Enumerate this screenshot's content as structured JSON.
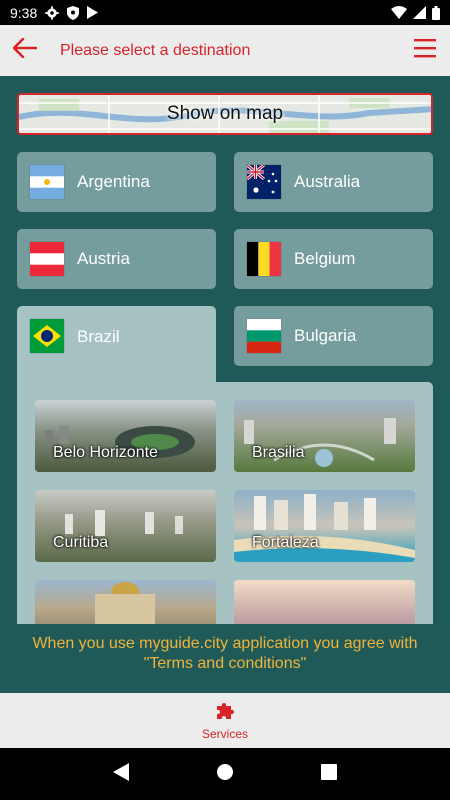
{
  "status_bar": {
    "time": "9:38"
  },
  "app_bar": {
    "title": "Please select a destination"
  },
  "map_banner": {
    "label": "Show on map"
  },
  "countries": [
    {
      "name": "Argentina"
    },
    {
      "name": "Australia"
    },
    {
      "name": "Austria"
    },
    {
      "name": "Belgium"
    },
    {
      "name": "Brazil",
      "selected": true
    },
    {
      "name": "Bulgaria"
    }
  ],
  "cities": [
    {
      "name": "Belo Horizonte"
    },
    {
      "name": "Brasilia"
    },
    {
      "name": "Curitiba"
    },
    {
      "name": "Fortaleza"
    },
    {
      "name": ""
    },
    {
      "name": ""
    }
  ],
  "terms_text": "When you use myguide.city application you agree with \"Terms and conditions\"",
  "bottom_nav": {
    "services_label": "Services"
  },
  "colors": {
    "accent": "#d8232a",
    "background": "#1f5a59",
    "card": "#759d9d",
    "card_active": "#a6c2c2",
    "terms": "#f0b33b"
  }
}
